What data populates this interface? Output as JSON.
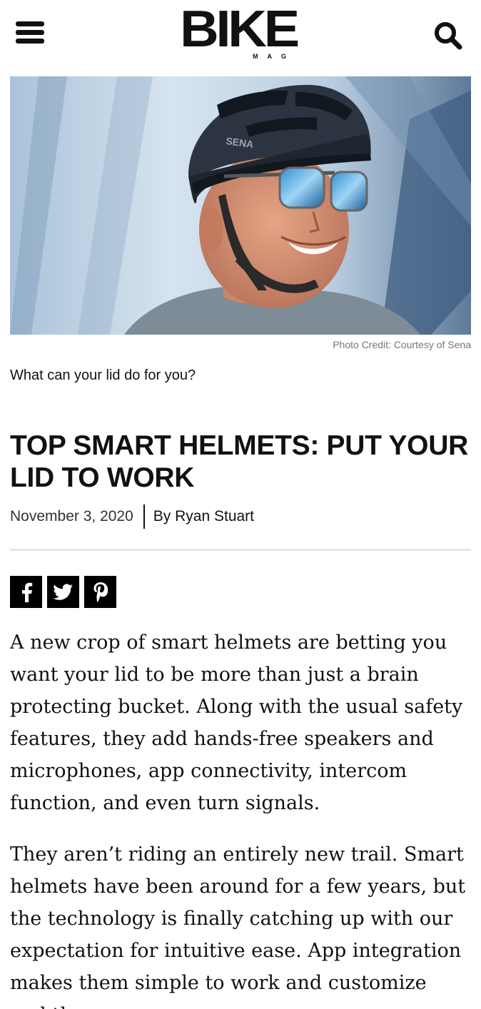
{
  "header": {
    "logo_main": "BIKE",
    "logo_sub": "MAG",
    "menu_icon": "hamburger-menu-icon",
    "search_icon": "search-icon"
  },
  "hero": {
    "photo_credit": "Photo Credit: Courtesy of Sena",
    "caption": "What can your lid do for you?",
    "helmet_brand_text": "SENA"
  },
  "article": {
    "title": "TOP SMART HELMETS: PUT YOUR LID TO WORK",
    "date": "November 3, 2020",
    "author": "By Ryan Stuart",
    "share": [
      "facebook-icon",
      "twitter-icon",
      "pinterest-icon"
    ],
    "paragraphs": [
      "A new crop of smart helmets are betting you want your lid to be more than just a brain protecting bucket. Along with the usual safety features, they add hands-free speakers and microphones, app connectivity, intercom function, and even turn signals.",
      "They aren’t riding an entirely new trail. Smart helmets have been around for a few years, but the technology is finally catching up with our expectation for intuitive ease. App integration makes them simple to work and customize and the"
    ]
  },
  "colors": {
    "text": "#111111",
    "credit": "#777777",
    "divider": "#e6e6e6",
    "share_bg": "#000000"
  }
}
